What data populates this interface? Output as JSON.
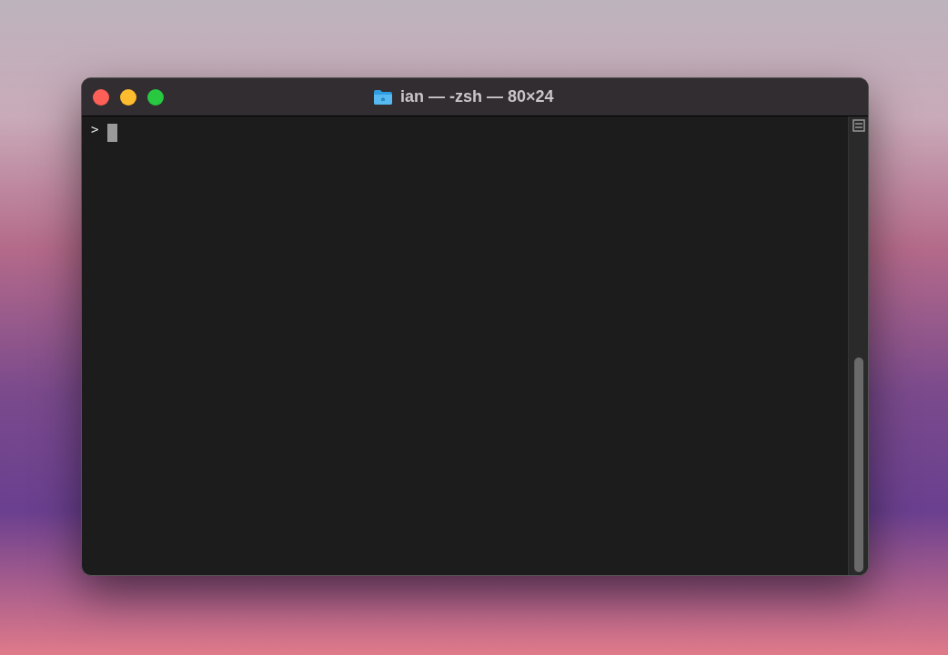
{
  "window": {
    "title": "ian — -zsh — 80×24"
  },
  "terminal": {
    "prompt": ">"
  }
}
